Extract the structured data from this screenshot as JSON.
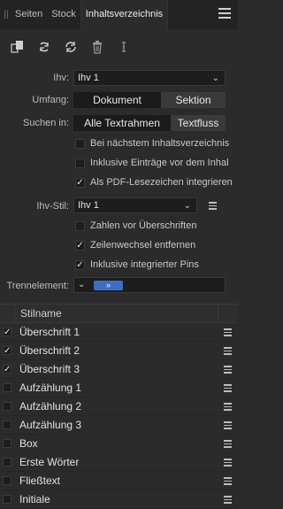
{
  "tabs": [
    {
      "label": "Seiten"
    },
    {
      "label": "Stock"
    },
    {
      "label": "Inhaltsverzeichnis"
    }
  ],
  "form": {
    "ihv_label": "Ihv:",
    "ihv_value": "Ihv 1",
    "umfang_label": "Umfang:",
    "umfang_options": [
      "Dokument",
      "Sektion"
    ],
    "suchen_label": "Suchen in:",
    "suchen_options": [
      "Alle Textrahmen",
      "Textfluss"
    ],
    "checks1": [
      {
        "label": "Bei nächstem Inhaltsverzeichnis",
        "checked": false
      },
      {
        "label": "Inklusive Einträge vor dem Inhal",
        "checked": false
      },
      {
        "label": "Als PDF-Lesezeichen integrieren",
        "checked": true
      }
    ],
    "stil_label": "Ihv-Stil:",
    "stil_value": "Ihv 1",
    "checks2": [
      {
        "label": "Zahlen vor Überschriften",
        "checked": false
      },
      {
        "label": "Zeilenwechsel entfernen",
        "checked": true
      },
      {
        "label": "Inklusive integrierter Pins",
        "checked": true
      }
    ],
    "trenn_label": "Trennelement:",
    "trenn_chip": "»"
  },
  "table": {
    "header": "Stilname",
    "rows": [
      {
        "name": "Überschrift 1",
        "checked": true
      },
      {
        "name": "Überschrift 2",
        "checked": true
      },
      {
        "name": "Überschrift 3",
        "checked": true
      },
      {
        "name": "Aufzählung 1",
        "checked": false
      },
      {
        "name": "Aufzählung 2",
        "checked": false
      },
      {
        "name": "Aufzählung 3",
        "checked": false
      },
      {
        "name": "Box",
        "checked": false
      },
      {
        "name": "Erste Wörter",
        "checked": false
      },
      {
        "name": "Fließtext",
        "checked": false
      },
      {
        "name": "Initiale",
        "checked": false
      }
    ]
  }
}
